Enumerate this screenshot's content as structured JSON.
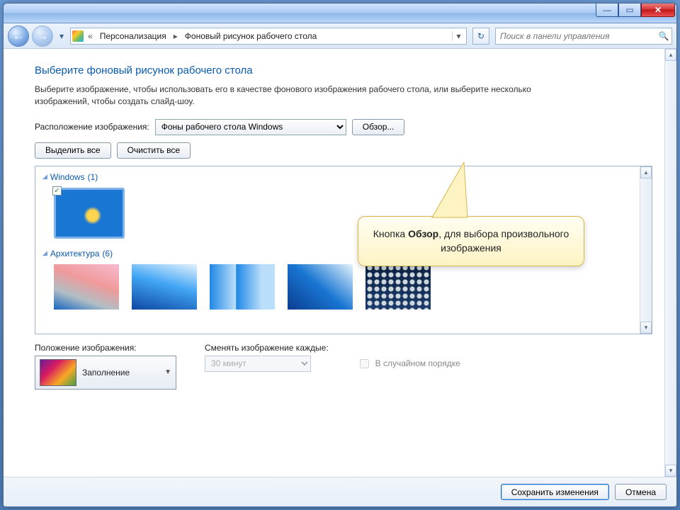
{
  "breadcrumb": {
    "crumb1": "Персонализация",
    "crumb2": "Фоновый рисунок рабочего стола"
  },
  "search": {
    "placeholder": "Поиск в панели управления"
  },
  "page": {
    "title": "Выберите фоновый рисунок рабочего стола",
    "description": "Выберите изображение, чтобы использовать его в качестве фонового изображения рабочего стола, или выберите несколько изображений, чтобы создать слайд-шоу."
  },
  "location": {
    "label": "Расположение изображения:",
    "value": "Фоны рабочего стола Windows",
    "browse": "Обзор..."
  },
  "toolbar": {
    "select_all": "Выделить все",
    "clear_all": "Очистить все"
  },
  "groups": [
    {
      "name": "Windows",
      "count": "(1)",
      "items": 1
    },
    {
      "name": "Архитектура",
      "count": "(6)",
      "items": 5
    }
  ],
  "position": {
    "label": "Положение изображения:",
    "value": "Заполнение"
  },
  "interval": {
    "label": "Сменять изображение каждые:",
    "value": "30 минут"
  },
  "shuffle": {
    "label": "В случайном порядке"
  },
  "footer": {
    "save": "Сохранить изменения",
    "cancel": "Отмена"
  },
  "callout": {
    "prefix": "Кнопка ",
    "bold": "Обзор",
    "suffix": ", для выбора произвольного изображения"
  }
}
